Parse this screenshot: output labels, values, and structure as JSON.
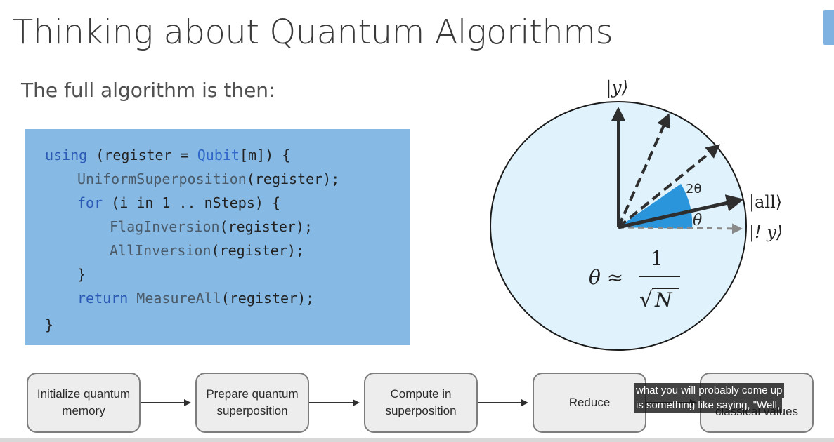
{
  "slide": {
    "title": "Thinking about Quantum Algorithms",
    "subtitle": "The full algorithm is then:"
  },
  "code": {
    "l1_kw": "using",
    "l1_a": " (register = ",
    "l1_type": "Qubit",
    "l1_b": "[m]) {",
    "l2_fn": "UniformSuperposition",
    "l2_rest": "(register);",
    "l3_kw": "for",
    "l3_rest": " (i in 1 .. nSteps) {",
    "l4_fn": "FlagInversion",
    "l4_rest": "(register);",
    "l5_fn": "AllInversion",
    "l5_rest": "(register);",
    "l6": "}",
    "l7_kw": "return",
    "l7_a": " ",
    "l7_fn": "MeasureAll",
    "l7_rest": "(register);",
    "l8": "}"
  },
  "diagram": {
    "label_y": "|y⟩",
    "label_all": "|all⟩",
    "label_not_y": "|! y⟩",
    "label_2theta": "2θ",
    "label_theta": "θ",
    "formula_lhs": "θ ≈",
    "formula_num": "1",
    "formula_sqrt": "√",
    "formula_den": "N",
    "colors": {
      "circle_fill": "#e0f2fb",
      "wedge_fill": "#2b95dc",
      "vector": "#2e2e2e",
      "not_y_vector": "#8a8a8a"
    }
  },
  "flow": {
    "steps": [
      [
        "Initialize quantum",
        "memory"
      ],
      [
        "Prepare quantum",
        "superposition"
      ],
      [
        "Compute in",
        "superposition"
      ],
      [
        "Reduce"
      ],
      [
        "classical values"
      ]
    ]
  },
  "caption": {
    "line1": "what you will probably come up",
    "line2": "is something like saying, \"Well,"
  }
}
